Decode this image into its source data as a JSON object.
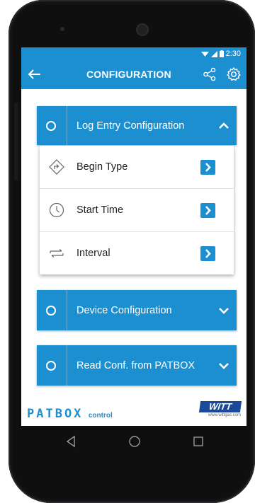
{
  "status_bar": {
    "time": "2:30"
  },
  "app_bar": {
    "title": "CONFIGURATION",
    "back_icon": "arrow-left-icon",
    "share_icon": "share-icon",
    "settings_icon": "gear-icon"
  },
  "sections": [
    {
      "label": "Log Entry Configuration",
      "expanded": true
    },
    {
      "label": "Device Configuration",
      "expanded": false
    },
    {
      "label": "Read Conf. from PATBOX",
      "expanded": false
    }
  ],
  "submenu": [
    {
      "label": "Begin Type",
      "icon": "begin-type-icon"
    },
    {
      "label": "Start Time",
      "icon": "clock-icon"
    },
    {
      "label": "Interval",
      "icon": "interval-icon"
    }
  ],
  "footer": {
    "logo_text": "PATBOX",
    "logo_suffix": "control",
    "brand": "WITT",
    "brand_url": "www.wittgas.com"
  },
  "colors": {
    "primary": "#1b8fd0"
  }
}
